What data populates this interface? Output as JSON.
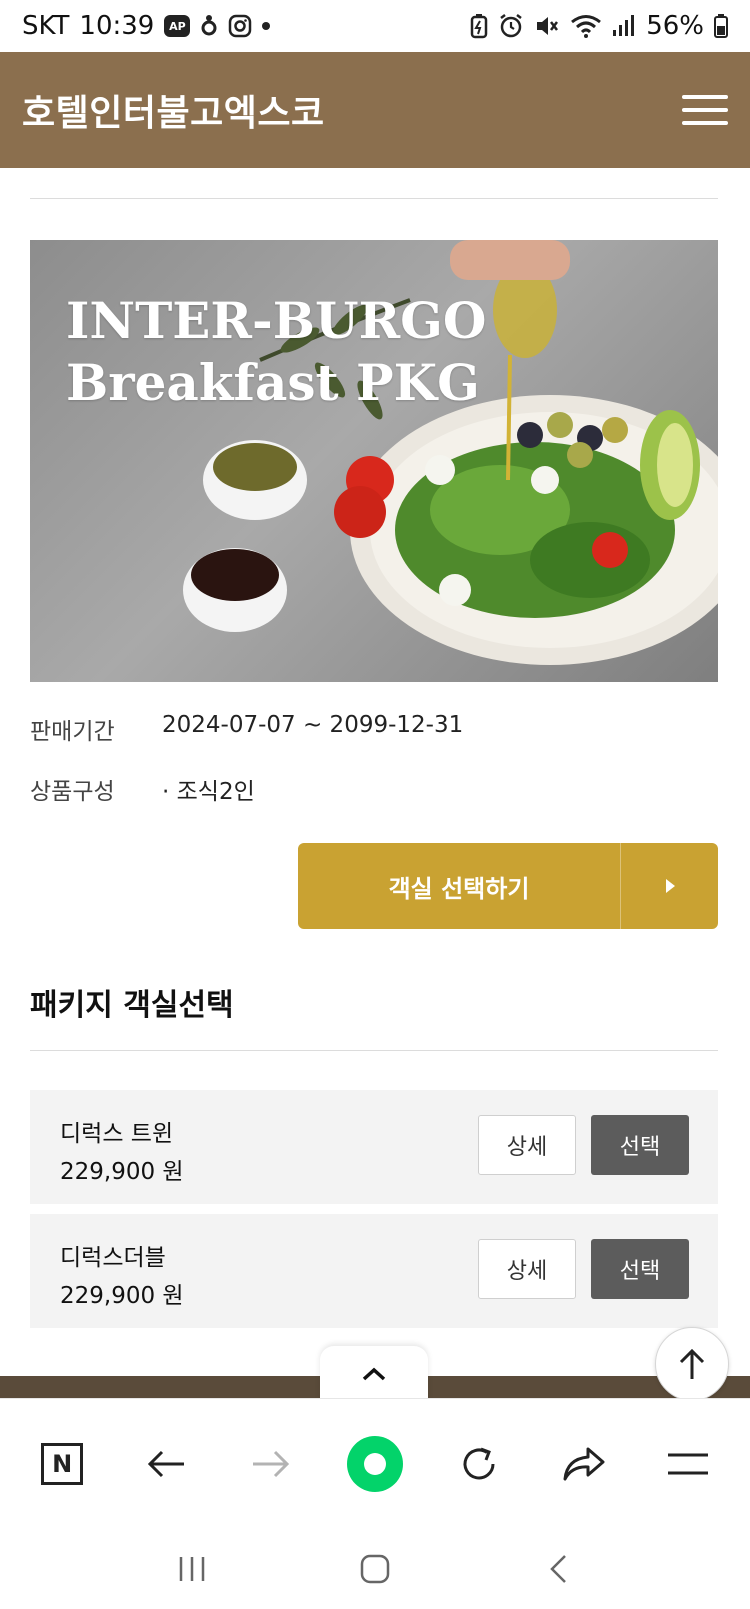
{
  "status_bar": {
    "carrier": "SKT",
    "time": "10:39",
    "app_badge": "AP",
    "battery": "56%"
  },
  "header": {
    "title": "호텔인터불고엑스코"
  },
  "hero": {
    "title_line1": "INTER-BURGO",
    "title_line2": "Breakfast PKG"
  },
  "info": {
    "period_label": "판매기간",
    "period_value": "2024-07-07 ~ 2099-12-31",
    "composition_label": "상품구성",
    "composition_value": "· 조식2인"
  },
  "select_room_button": {
    "label": "객실 선택하기"
  },
  "rooms_section": {
    "title": "패키지 객실선택",
    "rooms": [
      {
        "name": "디럭스 트윈",
        "price": "229,900 원",
        "detail_label": "상세",
        "select_label": "선택"
      },
      {
        "name": "디럭스더블",
        "price": "229,900 원",
        "detail_label": "상세",
        "select_label": "선택"
      }
    ]
  },
  "browser_bar": {
    "logo": "N",
    "icons": [
      "n-logo-icon",
      "back-arrow-icon",
      "forward-arrow-icon",
      "green-dot-icon",
      "refresh-icon",
      "share-icon",
      "menu-icon"
    ]
  },
  "colors": {
    "header_bg": "#8b6f4e",
    "accent_gold": "#c9a232",
    "select_btn": "#5c5c5c",
    "green": "#03d36a"
  }
}
